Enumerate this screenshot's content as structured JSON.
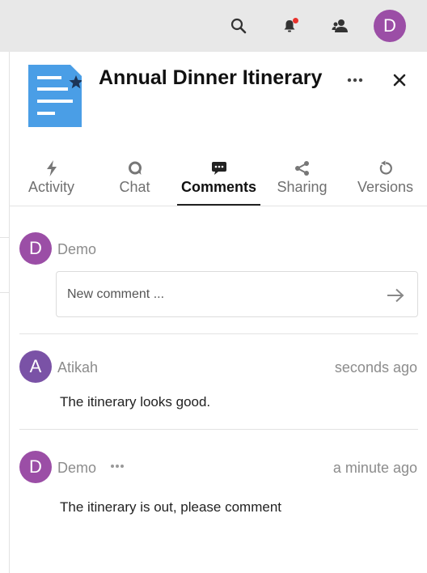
{
  "topbar": {
    "icons": [
      "search-icon",
      "notifications-icon",
      "contacts-icon"
    ],
    "user_initial": "D",
    "avatar_color": "#9b4ea6"
  },
  "file": {
    "title": "Annual Dinner Itinerary",
    "icon": "document-starred-icon",
    "icon_color": "#4a9ee6"
  },
  "tabs": [
    {
      "label": "Activity",
      "icon": "flash-icon"
    },
    {
      "label": "Chat",
      "icon": "chat-bubble-icon"
    },
    {
      "label": "Comments",
      "icon": "comment-icon",
      "active": true
    },
    {
      "label": "Sharing",
      "icon": "share-icon"
    },
    {
      "label": "Versions",
      "icon": "history-icon"
    }
  ],
  "new_comment": {
    "author": "Demo",
    "author_initial": "D",
    "placeholder": "New comment ..."
  },
  "comments": [
    {
      "author": "Atikah",
      "initial": "A",
      "color": "#7a52a6",
      "time": "seconds ago",
      "text": "The itinerary looks good."
    },
    {
      "author": "Demo",
      "initial": "D",
      "color": "#9b4ea6",
      "time": "a minute ago",
      "text": "The itinerary is out, please comment"
    }
  ]
}
